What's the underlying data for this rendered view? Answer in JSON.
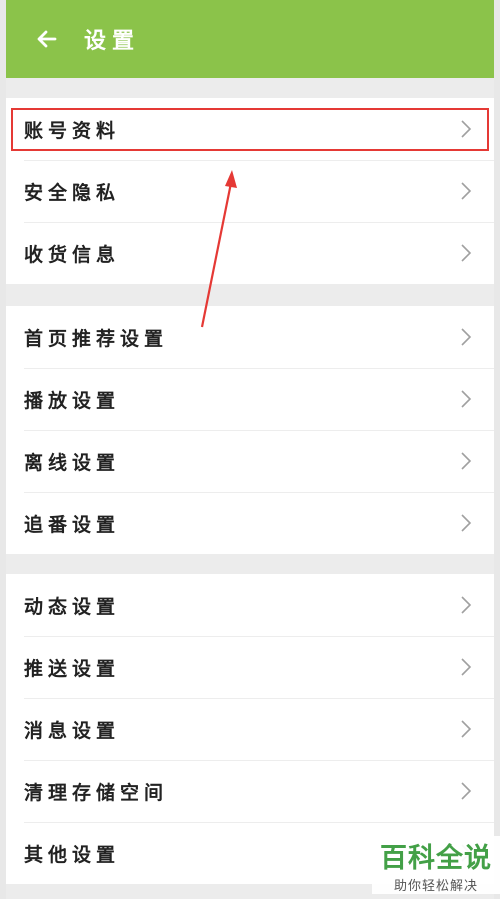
{
  "header": {
    "title": "设置",
    "back_icon": "arrow-left-icon"
  },
  "groups": [
    {
      "items": [
        {
          "label": "账号资料"
        },
        {
          "label": "安全隐私"
        },
        {
          "label": "收货信息"
        }
      ]
    },
    {
      "items": [
        {
          "label": "首页推荐设置"
        },
        {
          "label": "播放设置"
        },
        {
          "label": "离线设置"
        },
        {
          "label": "追番设置"
        }
      ]
    },
    {
      "items": [
        {
          "label": "动态设置"
        },
        {
          "label": "推送设置"
        },
        {
          "label": "消息设置"
        },
        {
          "label": "清理存储空间"
        },
        {
          "label": "其他设置"
        }
      ]
    }
  ],
  "watermark": {
    "brand": "百科全说",
    "subtitle": "助你轻松解决"
  },
  "colors": {
    "header_bg": "#8bc34a",
    "highlight": "#e53935",
    "watermark_green": "#43a047"
  }
}
